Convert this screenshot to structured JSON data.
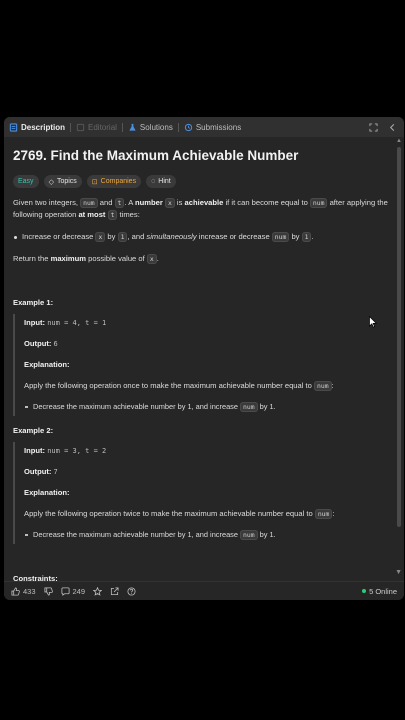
{
  "tabs": {
    "description": "Description",
    "editorial": "Editorial",
    "solutions": "Solutions",
    "submissions": "Submissions"
  },
  "problem": {
    "title": "2769. Find the Maximum Achievable Number",
    "tags": {
      "difficulty": "Easy",
      "topics": "Topics",
      "companies": "Companies",
      "hint": "Hint"
    }
  },
  "description": {
    "p1_a": "Given two integers, ",
    "p1_num": "num",
    "p1_b": " and ",
    "p1_t": "t",
    "p1_c": ". A ",
    "p1_number": "number",
    "p1_d": " ",
    "p1_x": "x",
    "p1_e": " is ",
    "p1_achievable": "achievable",
    "p1_f": " if it can become equal to ",
    "p1_num2": "num",
    "p1_g": " after applying the following operation ",
    "p1_atmost": "at most",
    "p1_h": " ",
    "p1_t2": "t",
    "p1_i": " times:",
    "b1_a": "Increase or decrease ",
    "b1_x": "x",
    "b1_b": " by ",
    "b1_1": "1",
    "b1_c": ", and ",
    "b1_sim": "simultaneously",
    "b1_d": " increase or decrease ",
    "b1_num": "num",
    "b1_e": " by ",
    "b1_1b": "1",
    "b1_f": ".",
    "r_a": "Return the ",
    "r_max": "maximum",
    "r_b": " possible value of ",
    "r_x": "x",
    "r_c": "."
  },
  "examples": [
    {
      "title": "Example 1:",
      "input_label": "Input:",
      "input_value": "num = 4, t = 1",
      "output_label": "Output:",
      "output_value": "6",
      "explanation_label": "Explanation:",
      "explanation_a": "Apply the following operation once to make the maximum achievable number equal to ",
      "explanation_num": "num",
      "explanation_b": ":",
      "step_a": "Decrease the maximum achievable number by 1, and increase ",
      "step_num": "num",
      "step_b": " by 1."
    },
    {
      "title": "Example 2:",
      "input_label": "Input:",
      "input_value": "num = 3, t = 2",
      "output_label": "Output:",
      "output_value": "7",
      "explanation_label": "Explanation:",
      "explanation_a": "Apply the following operation twice to make the maximum achievable number equal to ",
      "explanation_num": "num",
      "explanation_b": ":",
      "step_a": "Decrease the maximum achievable number by 1, and increase ",
      "step_num": "num",
      "step_b": " by 1."
    }
  ],
  "constraints_title": "Constraints:",
  "footer": {
    "likes": "433",
    "comments": "249",
    "online": "5 Online"
  },
  "colors": {
    "easy": "#34c6b0",
    "companies": "#f0a63b",
    "online_dot": "#2ecc71",
    "panel_bg": "#262626"
  }
}
